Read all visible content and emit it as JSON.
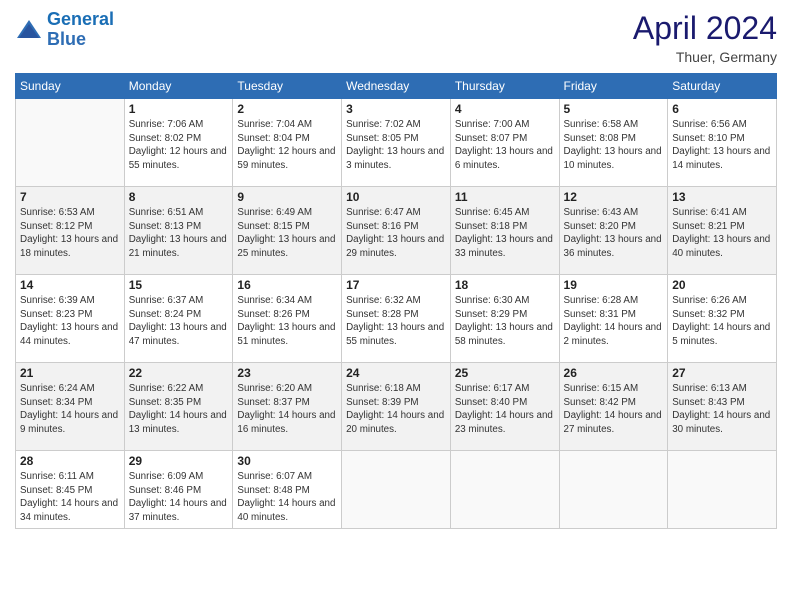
{
  "header": {
    "logo_line1": "General",
    "logo_line2": "Blue",
    "month_year": "April 2024",
    "location": "Thuer, Germany"
  },
  "weekdays": [
    "Sunday",
    "Monday",
    "Tuesday",
    "Wednesday",
    "Thursday",
    "Friday",
    "Saturday"
  ],
  "weeks": [
    [
      {
        "day": "",
        "sunrise": "",
        "sunset": "",
        "daylight": ""
      },
      {
        "day": "1",
        "sunrise": "Sunrise: 7:06 AM",
        "sunset": "Sunset: 8:02 PM",
        "daylight": "Daylight: 12 hours and 55 minutes."
      },
      {
        "day": "2",
        "sunrise": "Sunrise: 7:04 AM",
        "sunset": "Sunset: 8:04 PM",
        "daylight": "Daylight: 12 hours and 59 minutes."
      },
      {
        "day": "3",
        "sunrise": "Sunrise: 7:02 AM",
        "sunset": "Sunset: 8:05 PM",
        "daylight": "Daylight: 13 hours and 3 minutes."
      },
      {
        "day": "4",
        "sunrise": "Sunrise: 7:00 AM",
        "sunset": "Sunset: 8:07 PM",
        "daylight": "Daylight: 13 hours and 6 minutes."
      },
      {
        "day": "5",
        "sunrise": "Sunrise: 6:58 AM",
        "sunset": "Sunset: 8:08 PM",
        "daylight": "Daylight: 13 hours and 10 minutes."
      },
      {
        "day": "6",
        "sunrise": "Sunrise: 6:56 AM",
        "sunset": "Sunset: 8:10 PM",
        "daylight": "Daylight: 13 hours and 14 minutes."
      }
    ],
    [
      {
        "day": "7",
        "sunrise": "Sunrise: 6:53 AM",
        "sunset": "Sunset: 8:12 PM",
        "daylight": "Daylight: 13 hours and 18 minutes."
      },
      {
        "day": "8",
        "sunrise": "Sunrise: 6:51 AM",
        "sunset": "Sunset: 8:13 PM",
        "daylight": "Daylight: 13 hours and 21 minutes."
      },
      {
        "day": "9",
        "sunrise": "Sunrise: 6:49 AM",
        "sunset": "Sunset: 8:15 PM",
        "daylight": "Daylight: 13 hours and 25 minutes."
      },
      {
        "day": "10",
        "sunrise": "Sunrise: 6:47 AM",
        "sunset": "Sunset: 8:16 PM",
        "daylight": "Daylight: 13 hours and 29 minutes."
      },
      {
        "day": "11",
        "sunrise": "Sunrise: 6:45 AM",
        "sunset": "Sunset: 8:18 PM",
        "daylight": "Daylight: 13 hours and 33 minutes."
      },
      {
        "day": "12",
        "sunrise": "Sunrise: 6:43 AM",
        "sunset": "Sunset: 8:20 PM",
        "daylight": "Daylight: 13 hours and 36 minutes."
      },
      {
        "day": "13",
        "sunrise": "Sunrise: 6:41 AM",
        "sunset": "Sunset: 8:21 PM",
        "daylight": "Daylight: 13 hours and 40 minutes."
      }
    ],
    [
      {
        "day": "14",
        "sunrise": "Sunrise: 6:39 AM",
        "sunset": "Sunset: 8:23 PM",
        "daylight": "Daylight: 13 hours and 44 minutes."
      },
      {
        "day": "15",
        "sunrise": "Sunrise: 6:37 AM",
        "sunset": "Sunset: 8:24 PM",
        "daylight": "Daylight: 13 hours and 47 minutes."
      },
      {
        "day": "16",
        "sunrise": "Sunrise: 6:34 AM",
        "sunset": "Sunset: 8:26 PM",
        "daylight": "Daylight: 13 hours and 51 minutes."
      },
      {
        "day": "17",
        "sunrise": "Sunrise: 6:32 AM",
        "sunset": "Sunset: 8:28 PM",
        "daylight": "Daylight: 13 hours and 55 minutes."
      },
      {
        "day": "18",
        "sunrise": "Sunrise: 6:30 AM",
        "sunset": "Sunset: 8:29 PM",
        "daylight": "Daylight: 13 hours and 58 minutes."
      },
      {
        "day": "19",
        "sunrise": "Sunrise: 6:28 AM",
        "sunset": "Sunset: 8:31 PM",
        "daylight": "Daylight: 14 hours and 2 minutes."
      },
      {
        "day": "20",
        "sunrise": "Sunrise: 6:26 AM",
        "sunset": "Sunset: 8:32 PM",
        "daylight": "Daylight: 14 hours and 5 minutes."
      }
    ],
    [
      {
        "day": "21",
        "sunrise": "Sunrise: 6:24 AM",
        "sunset": "Sunset: 8:34 PM",
        "daylight": "Daylight: 14 hours and 9 minutes."
      },
      {
        "day": "22",
        "sunrise": "Sunrise: 6:22 AM",
        "sunset": "Sunset: 8:35 PM",
        "daylight": "Daylight: 14 hours and 13 minutes."
      },
      {
        "day": "23",
        "sunrise": "Sunrise: 6:20 AM",
        "sunset": "Sunset: 8:37 PM",
        "daylight": "Daylight: 14 hours and 16 minutes."
      },
      {
        "day": "24",
        "sunrise": "Sunrise: 6:18 AM",
        "sunset": "Sunset: 8:39 PM",
        "daylight": "Daylight: 14 hours and 20 minutes."
      },
      {
        "day": "25",
        "sunrise": "Sunrise: 6:17 AM",
        "sunset": "Sunset: 8:40 PM",
        "daylight": "Daylight: 14 hours and 23 minutes."
      },
      {
        "day": "26",
        "sunrise": "Sunrise: 6:15 AM",
        "sunset": "Sunset: 8:42 PM",
        "daylight": "Daylight: 14 hours and 27 minutes."
      },
      {
        "day": "27",
        "sunrise": "Sunrise: 6:13 AM",
        "sunset": "Sunset: 8:43 PM",
        "daylight": "Daylight: 14 hours and 30 minutes."
      }
    ],
    [
      {
        "day": "28",
        "sunrise": "Sunrise: 6:11 AM",
        "sunset": "Sunset: 8:45 PM",
        "daylight": "Daylight: 14 hours and 34 minutes."
      },
      {
        "day": "29",
        "sunrise": "Sunrise: 6:09 AM",
        "sunset": "Sunset: 8:46 PM",
        "daylight": "Daylight: 14 hours and 37 minutes."
      },
      {
        "day": "30",
        "sunrise": "Sunrise: 6:07 AM",
        "sunset": "Sunset: 8:48 PM",
        "daylight": "Daylight: 14 hours and 40 minutes."
      },
      {
        "day": "",
        "sunrise": "",
        "sunset": "",
        "daylight": ""
      },
      {
        "day": "",
        "sunrise": "",
        "sunset": "",
        "daylight": ""
      },
      {
        "day": "",
        "sunrise": "",
        "sunset": "",
        "daylight": ""
      },
      {
        "day": "",
        "sunrise": "",
        "sunset": "",
        "daylight": ""
      }
    ]
  ]
}
